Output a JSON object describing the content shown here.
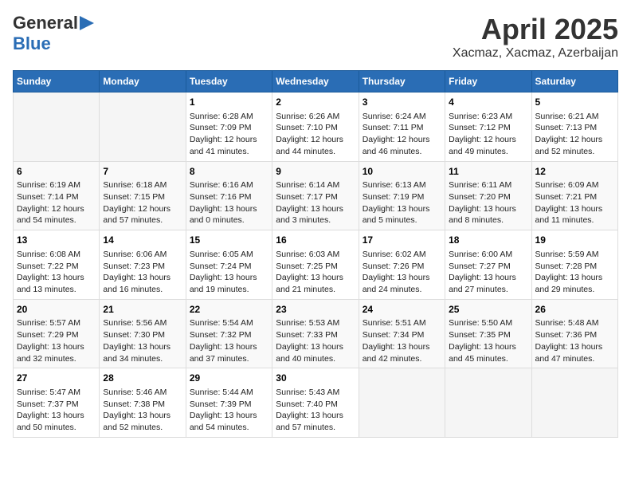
{
  "logo": {
    "general": "General",
    "blue": "Blue"
  },
  "title": "April 2025",
  "subtitle": "Xacmaz, Xacmaz, Azerbaijan",
  "headers": [
    "Sunday",
    "Monday",
    "Tuesday",
    "Wednesday",
    "Thursday",
    "Friday",
    "Saturday"
  ],
  "weeks": [
    [
      {
        "day": "",
        "content": ""
      },
      {
        "day": "",
        "content": ""
      },
      {
        "day": "1",
        "content": "Sunrise: 6:28 AM\nSunset: 7:09 PM\nDaylight: 12 hours and 41 minutes."
      },
      {
        "day": "2",
        "content": "Sunrise: 6:26 AM\nSunset: 7:10 PM\nDaylight: 12 hours and 44 minutes."
      },
      {
        "day": "3",
        "content": "Sunrise: 6:24 AM\nSunset: 7:11 PM\nDaylight: 12 hours and 46 minutes."
      },
      {
        "day": "4",
        "content": "Sunrise: 6:23 AM\nSunset: 7:12 PM\nDaylight: 12 hours and 49 minutes."
      },
      {
        "day": "5",
        "content": "Sunrise: 6:21 AM\nSunset: 7:13 PM\nDaylight: 12 hours and 52 minutes."
      }
    ],
    [
      {
        "day": "6",
        "content": "Sunrise: 6:19 AM\nSunset: 7:14 PM\nDaylight: 12 hours and 54 minutes."
      },
      {
        "day": "7",
        "content": "Sunrise: 6:18 AM\nSunset: 7:15 PM\nDaylight: 12 hours and 57 minutes."
      },
      {
        "day": "8",
        "content": "Sunrise: 6:16 AM\nSunset: 7:16 PM\nDaylight: 13 hours and 0 minutes."
      },
      {
        "day": "9",
        "content": "Sunrise: 6:14 AM\nSunset: 7:17 PM\nDaylight: 13 hours and 3 minutes."
      },
      {
        "day": "10",
        "content": "Sunrise: 6:13 AM\nSunset: 7:19 PM\nDaylight: 13 hours and 5 minutes."
      },
      {
        "day": "11",
        "content": "Sunrise: 6:11 AM\nSunset: 7:20 PM\nDaylight: 13 hours and 8 minutes."
      },
      {
        "day": "12",
        "content": "Sunrise: 6:09 AM\nSunset: 7:21 PM\nDaylight: 13 hours and 11 minutes."
      }
    ],
    [
      {
        "day": "13",
        "content": "Sunrise: 6:08 AM\nSunset: 7:22 PM\nDaylight: 13 hours and 13 minutes."
      },
      {
        "day": "14",
        "content": "Sunrise: 6:06 AM\nSunset: 7:23 PM\nDaylight: 13 hours and 16 minutes."
      },
      {
        "day": "15",
        "content": "Sunrise: 6:05 AM\nSunset: 7:24 PM\nDaylight: 13 hours and 19 minutes."
      },
      {
        "day": "16",
        "content": "Sunrise: 6:03 AM\nSunset: 7:25 PM\nDaylight: 13 hours and 21 minutes."
      },
      {
        "day": "17",
        "content": "Sunrise: 6:02 AM\nSunset: 7:26 PM\nDaylight: 13 hours and 24 minutes."
      },
      {
        "day": "18",
        "content": "Sunrise: 6:00 AM\nSunset: 7:27 PM\nDaylight: 13 hours and 27 minutes."
      },
      {
        "day": "19",
        "content": "Sunrise: 5:59 AM\nSunset: 7:28 PM\nDaylight: 13 hours and 29 minutes."
      }
    ],
    [
      {
        "day": "20",
        "content": "Sunrise: 5:57 AM\nSunset: 7:29 PM\nDaylight: 13 hours and 32 minutes."
      },
      {
        "day": "21",
        "content": "Sunrise: 5:56 AM\nSunset: 7:30 PM\nDaylight: 13 hours and 34 minutes."
      },
      {
        "day": "22",
        "content": "Sunrise: 5:54 AM\nSunset: 7:32 PM\nDaylight: 13 hours and 37 minutes."
      },
      {
        "day": "23",
        "content": "Sunrise: 5:53 AM\nSunset: 7:33 PM\nDaylight: 13 hours and 40 minutes."
      },
      {
        "day": "24",
        "content": "Sunrise: 5:51 AM\nSunset: 7:34 PM\nDaylight: 13 hours and 42 minutes."
      },
      {
        "day": "25",
        "content": "Sunrise: 5:50 AM\nSunset: 7:35 PM\nDaylight: 13 hours and 45 minutes."
      },
      {
        "day": "26",
        "content": "Sunrise: 5:48 AM\nSunset: 7:36 PM\nDaylight: 13 hours and 47 minutes."
      }
    ],
    [
      {
        "day": "27",
        "content": "Sunrise: 5:47 AM\nSunset: 7:37 PM\nDaylight: 13 hours and 50 minutes."
      },
      {
        "day": "28",
        "content": "Sunrise: 5:46 AM\nSunset: 7:38 PM\nDaylight: 13 hours and 52 minutes."
      },
      {
        "day": "29",
        "content": "Sunrise: 5:44 AM\nSunset: 7:39 PM\nDaylight: 13 hours and 54 minutes."
      },
      {
        "day": "30",
        "content": "Sunrise: 5:43 AM\nSunset: 7:40 PM\nDaylight: 13 hours and 57 minutes."
      },
      {
        "day": "",
        "content": ""
      },
      {
        "day": "",
        "content": ""
      },
      {
        "day": "",
        "content": ""
      }
    ]
  ]
}
